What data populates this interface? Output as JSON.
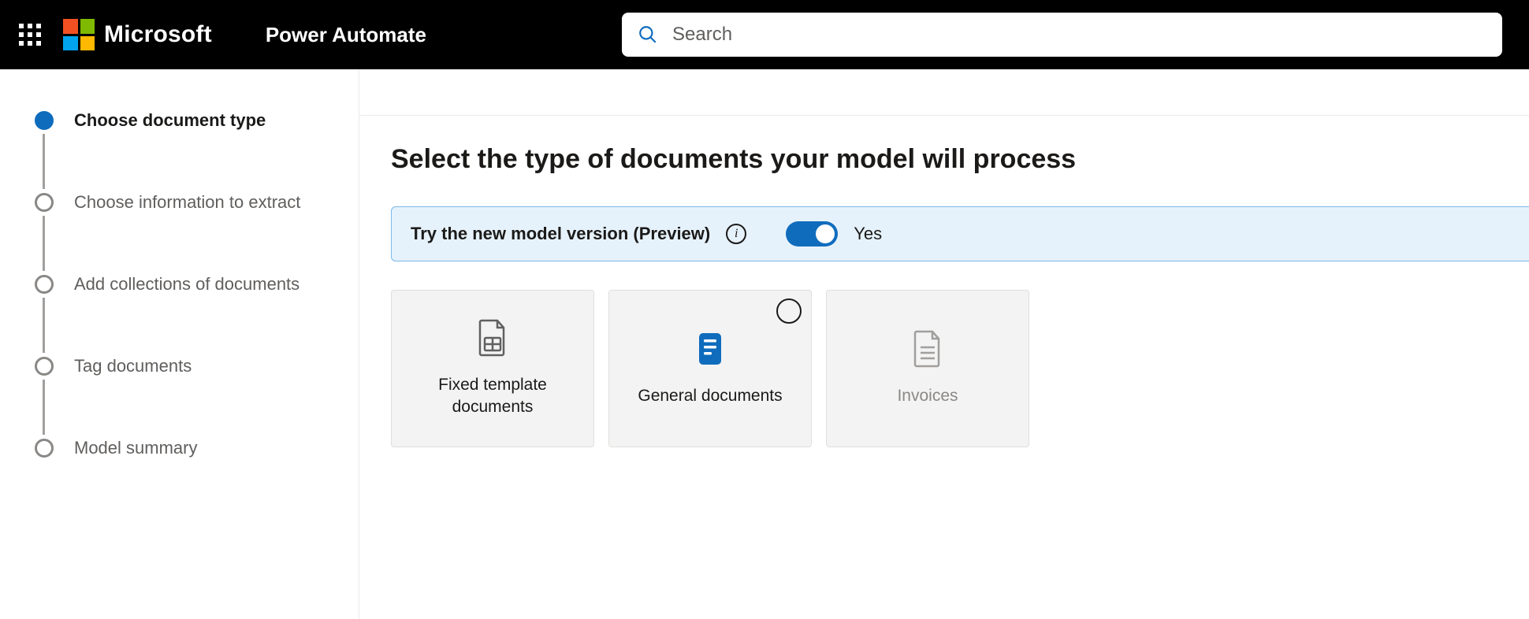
{
  "header": {
    "company": "Microsoft",
    "app_name": "Power Automate",
    "search_placeholder": "Search"
  },
  "sidebar": {
    "steps": [
      {
        "label": "Choose document type",
        "active": true
      },
      {
        "label": "Choose information to extract",
        "active": false
      },
      {
        "label": "Add collections of documents",
        "active": false
      },
      {
        "label": "Tag documents",
        "active": false
      },
      {
        "label": "Model summary",
        "active": false
      }
    ]
  },
  "main": {
    "title": "Select the type of documents your model will process",
    "banner": {
      "label": "Try the new model version (Preview)",
      "toggle_on": true,
      "toggle_text": "Yes"
    },
    "cards": [
      {
        "label": "Fixed template documents",
        "icon": "template-doc",
        "state": "default"
      },
      {
        "label": "General documents",
        "icon": "general-doc",
        "state": "hover"
      },
      {
        "label": "Invoices",
        "icon": "invoice-doc",
        "state": "disabled"
      }
    ]
  }
}
